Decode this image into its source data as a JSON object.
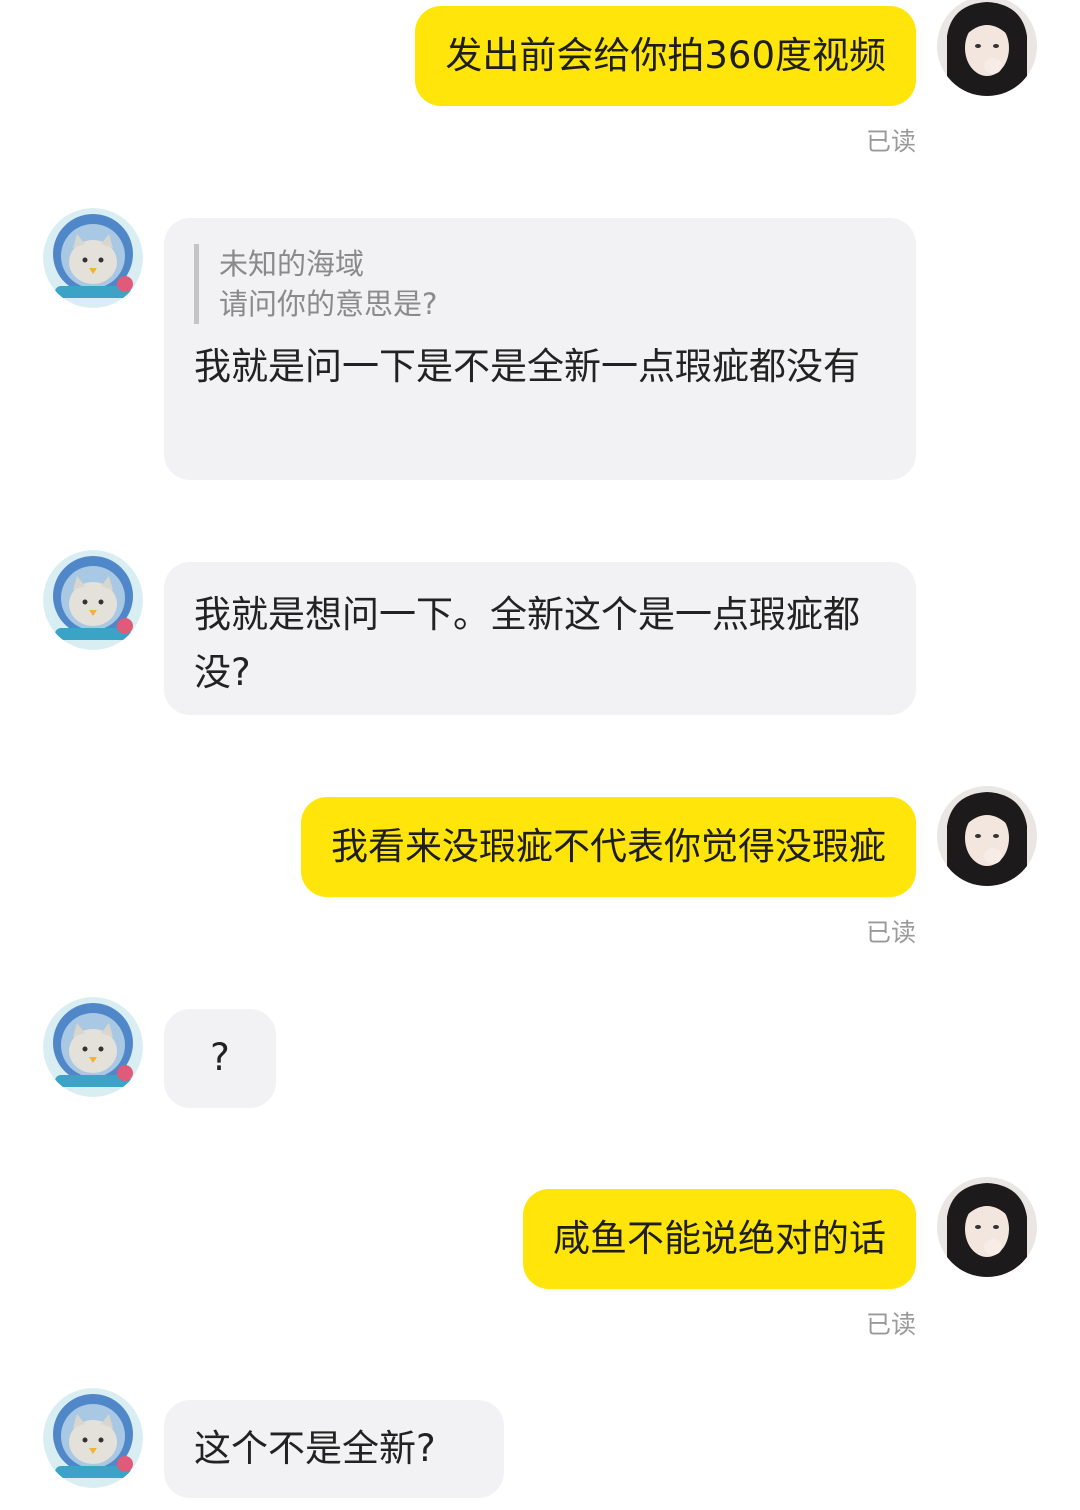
{
  "messages": [
    {
      "side": "out",
      "text": "发出前会给你拍360度视频",
      "status": "已读"
    },
    {
      "side": "in",
      "quote": {
        "author": "未知的海域",
        "text": "请问你的意思是?"
      },
      "text": "我就是问一下是不是全新一点瑕疵都没有"
    },
    {
      "side": "in",
      "text": "我就是想问一下。全新这个是一点瑕疵都没?"
    },
    {
      "side": "out",
      "text": "我看来没瑕疵不代表你觉得没瑕疵",
      "status": "已读"
    },
    {
      "side": "in",
      "text": "?"
    },
    {
      "side": "out",
      "text": "咸鱼不能说绝对的话",
      "status": "已读"
    },
    {
      "side": "in",
      "text": "这个不是全新?"
    }
  ],
  "avatars": {
    "self": "woman-photo-avatar",
    "other": "cat-astronaut-avatar"
  },
  "colors": {
    "outgoing_bubble": "#FFE50A",
    "incoming_bubble": "#F2F2F4",
    "status_text": "#9a9a9a"
  }
}
